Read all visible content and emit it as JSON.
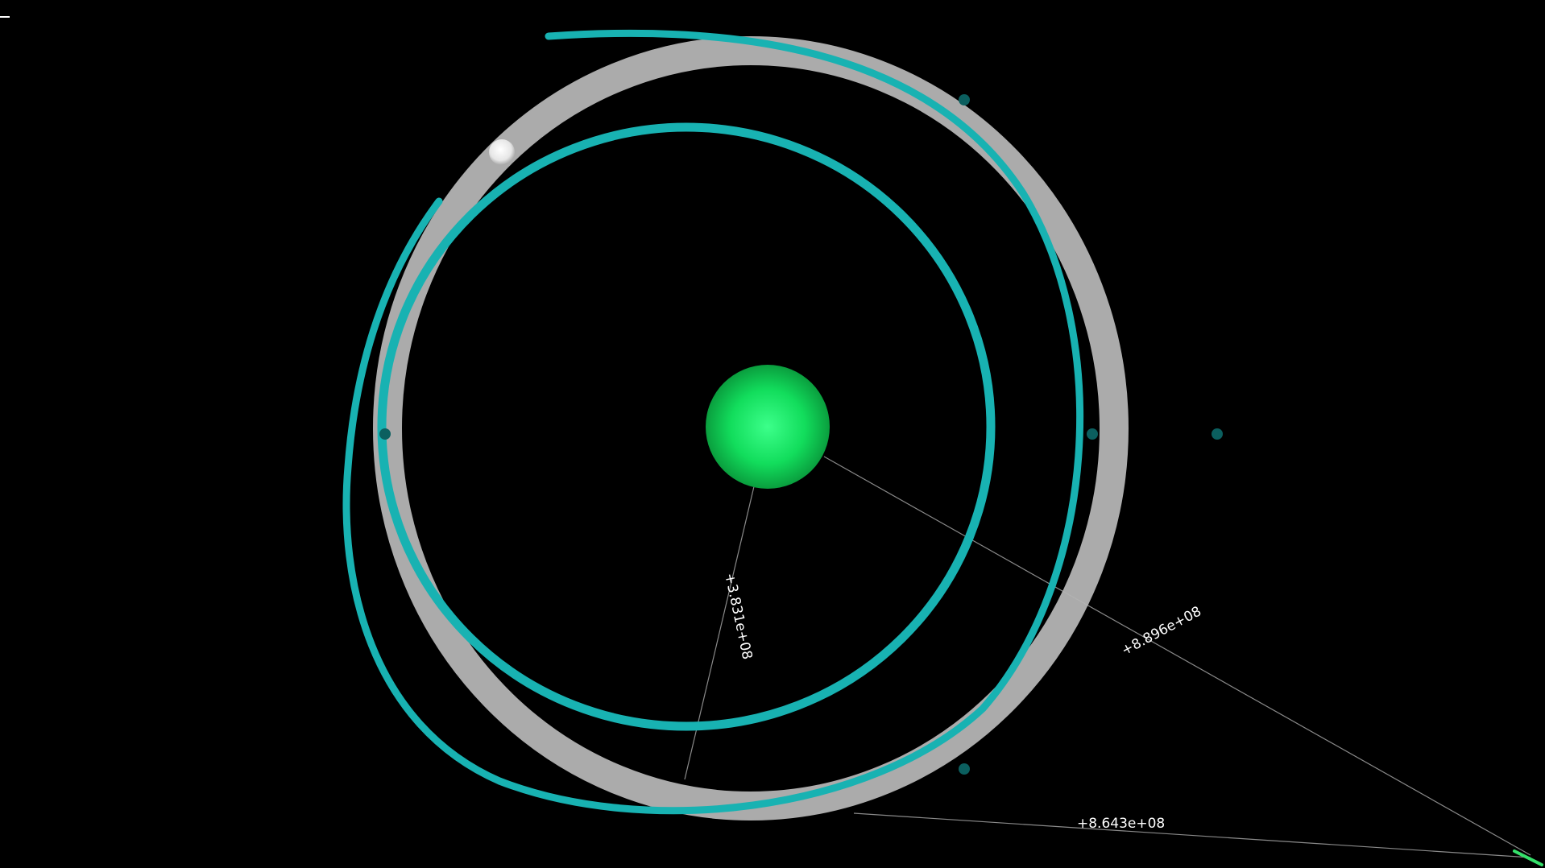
{
  "scene": {
    "background": "#000000",
    "central_body_color": "#10e060",
    "moon_color": "#f2f2f2",
    "orbit_band_color": "#b4b4b4",
    "trajectory_color": "#18b2b2",
    "marker_color": "#0b5f5f",
    "measurement_line_color": "#8a8a8a",
    "craft_color": "#35e06a"
  },
  "measurements": {
    "radial_distance": "+3.831e+08",
    "diagonal_distance": "+8.896e+08",
    "bottom_distance": "+8.643e+08"
  },
  "menu": {
    "icon": "minus-icon"
  }
}
